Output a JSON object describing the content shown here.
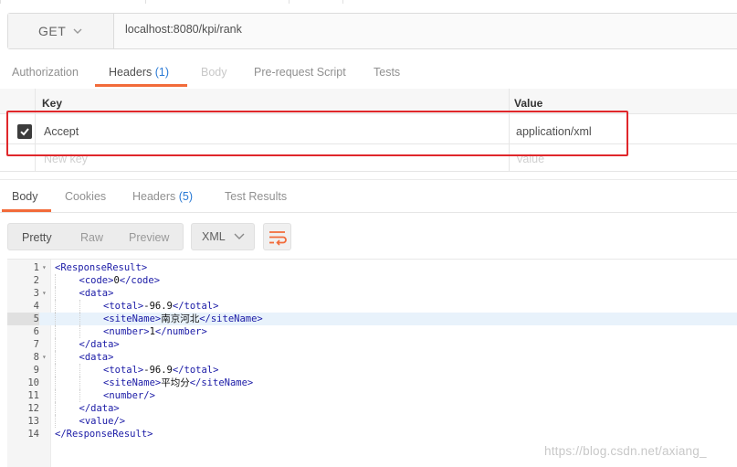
{
  "request": {
    "method": "GET",
    "url": "localhost:8080/kpi/rank"
  },
  "request_tabs": {
    "authorization": "Authorization",
    "headers": "Headers",
    "headers_count": "(1)",
    "body": "Body",
    "prerequest": "Pre-request Script",
    "tests": "Tests"
  },
  "headers_table": {
    "key_col": "Key",
    "value_col": "Value",
    "rows": [
      {
        "checked": true,
        "key": "Accept",
        "value": "application/xml"
      }
    ],
    "new_key_placeholder": "New key",
    "new_value_placeholder": "Value"
  },
  "response_tabs": {
    "body": "Body",
    "cookies": "Cookies",
    "headers": "Headers",
    "headers_count": "(5)",
    "test_results": "Test Results"
  },
  "format": {
    "pretty": "Pretty",
    "raw": "Raw",
    "preview": "Preview",
    "language": "XML"
  },
  "code": {
    "active_line": 5,
    "lines": [
      {
        "n": "1",
        "fold": true,
        "indent": 0,
        "parts": [
          [
            "t",
            "<ResponseResult>"
          ]
        ]
      },
      {
        "n": "2",
        "fold": false,
        "indent": 1,
        "parts": [
          [
            "t",
            "<code>"
          ],
          [
            "x",
            "0"
          ],
          [
            "t",
            "</code>"
          ]
        ]
      },
      {
        "n": "3",
        "fold": true,
        "indent": 1,
        "parts": [
          [
            "t",
            "<data>"
          ]
        ]
      },
      {
        "n": "4",
        "fold": false,
        "indent": 2,
        "parts": [
          [
            "t",
            "<total>"
          ],
          [
            "x",
            "-96.9"
          ],
          [
            "t",
            "</total>"
          ]
        ]
      },
      {
        "n": "5",
        "fold": false,
        "indent": 2,
        "parts": [
          [
            "t",
            "<siteName>"
          ],
          [
            "x",
            "南京河北"
          ],
          [
            "t",
            "</siteName>"
          ]
        ]
      },
      {
        "n": "6",
        "fold": false,
        "indent": 2,
        "parts": [
          [
            "t",
            "<number>"
          ],
          [
            "x",
            "1"
          ],
          [
            "t",
            "</number>"
          ]
        ]
      },
      {
        "n": "7",
        "fold": false,
        "indent": 1,
        "parts": [
          [
            "t",
            "</data>"
          ]
        ]
      },
      {
        "n": "8",
        "fold": true,
        "indent": 1,
        "parts": [
          [
            "t",
            "<data>"
          ]
        ]
      },
      {
        "n": "9",
        "fold": false,
        "indent": 2,
        "parts": [
          [
            "t",
            "<total>"
          ],
          [
            "x",
            "-96.9"
          ],
          [
            "t",
            "</total>"
          ]
        ]
      },
      {
        "n": "10",
        "fold": false,
        "indent": 2,
        "parts": [
          [
            "t",
            "<siteName>"
          ],
          [
            "x",
            "平均分"
          ],
          [
            "t",
            "</siteName>"
          ]
        ]
      },
      {
        "n": "11",
        "fold": false,
        "indent": 2,
        "parts": [
          [
            "t",
            "<number/>"
          ]
        ]
      },
      {
        "n": "12",
        "fold": false,
        "indent": 1,
        "parts": [
          [
            "t",
            "</data>"
          ]
        ]
      },
      {
        "n": "13",
        "fold": false,
        "indent": 1,
        "parts": [
          [
            "t",
            "<value/>"
          ]
        ]
      },
      {
        "n": "14",
        "fold": false,
        "indent": 0,
        "parts": [
          [
            "t",
            "</ResponseResult>"
          ]
        ]
      }
    ]
  },
  "watermark": "https://blog.csdn.net/axiang_",
  "colors": {
    "accent": "#f26b3a",
    "count_blue": "#2a7ad5",
    "highlight_red": "#e0272b",
    "xml_tag": "#1a1aa6"
  }
}
